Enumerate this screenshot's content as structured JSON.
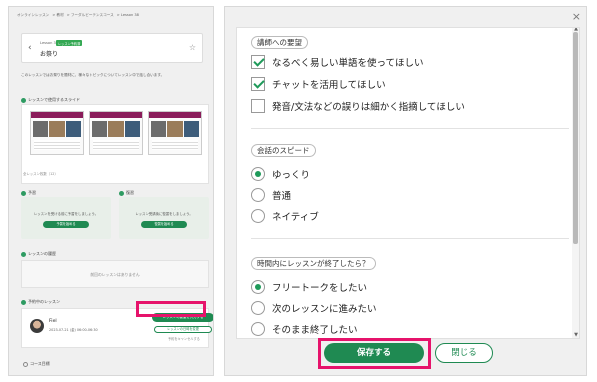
{
  "left": {
    "breadcrumbs": [
      "オンラインレッスン",
      "教材",
      "フーダルビーテンスコース",
      "Lesson 38"
    ],
    "lesson": {
      "number": "Lesson 38",
      "badge": "レッスン予約済",
      "title": "お祭り"
    },
    "intro_text": "このレッスンではお祭りを題材に、様々なトピックについてレッスン中で話し合います。",
    "slides_section_label": "レッスンで使用するスライド",
    "slides_caption": "全レッスン枚数（12）",
    "prep_card": {
      "label": "予習",
      "text": "レッスンを受ける前に予習をしましょう。",
      "button": "予習を始める"
    },
    "review_card": {
      "label": "復習",
      "text": "レッスン受講後に復習をしましょう。",
      "button": "復習を始める"
    },
    "history_label": "レッスンの履歴",
    "history_empty": "前回のレッスンはありません",
    "reservation_label": "予約中のレッスン",
    "tutor_name": "Fiel",
    "tutor_date": "2023-07-21 (金) 06:00-06:30",
    "request_button": "レッスンの要望を入力する",
    "change_button": "レッスンの日時を変更",
    "cancel_link": "予約をキャンセルする",
    "syllabus_label": "コース目標"
  },
  "right": {
    "q1": {
      "title": "講師への要望",
      "options": [
        {
          "label": "なるべく易しい単語を使ってほしい",
          "checked": true
        },
        {
          "label": "チャットを活用してほしい",
          "checked": true
        },
        {
          "label": "発音/文法などの誤りは細かく指摘してほしい",
          "checked": false
        }
      ]
    },
    "q2": {
      "title": "会話のスピード",
      "options": [
        {
          "label": "ゆっくり",
          "selected": true
        },
        {
          "label": "普通",
          "selected": false
        },
        {
          "label": "ネイティブ",
          "selected": false
        }
      ]
    },
    "q3": {
      "title": "時間内にレッスンが終了したら？",
      "options": [
        {
          "label": "フリートークをしたい",
          "selected": true
        },
        {
          "label": "次のレッスンに進みたい",
          "selected": false
        },
        {
          "label": "そのまま終了したい",
          "selected": false
        }
      ]
    },
    "save_button": "保存する",
    "close_button": "閉じる"
  },
  "colors": {
    "accent": "#1f8a52",
    "highlight": "#e6136b"
  }
}
